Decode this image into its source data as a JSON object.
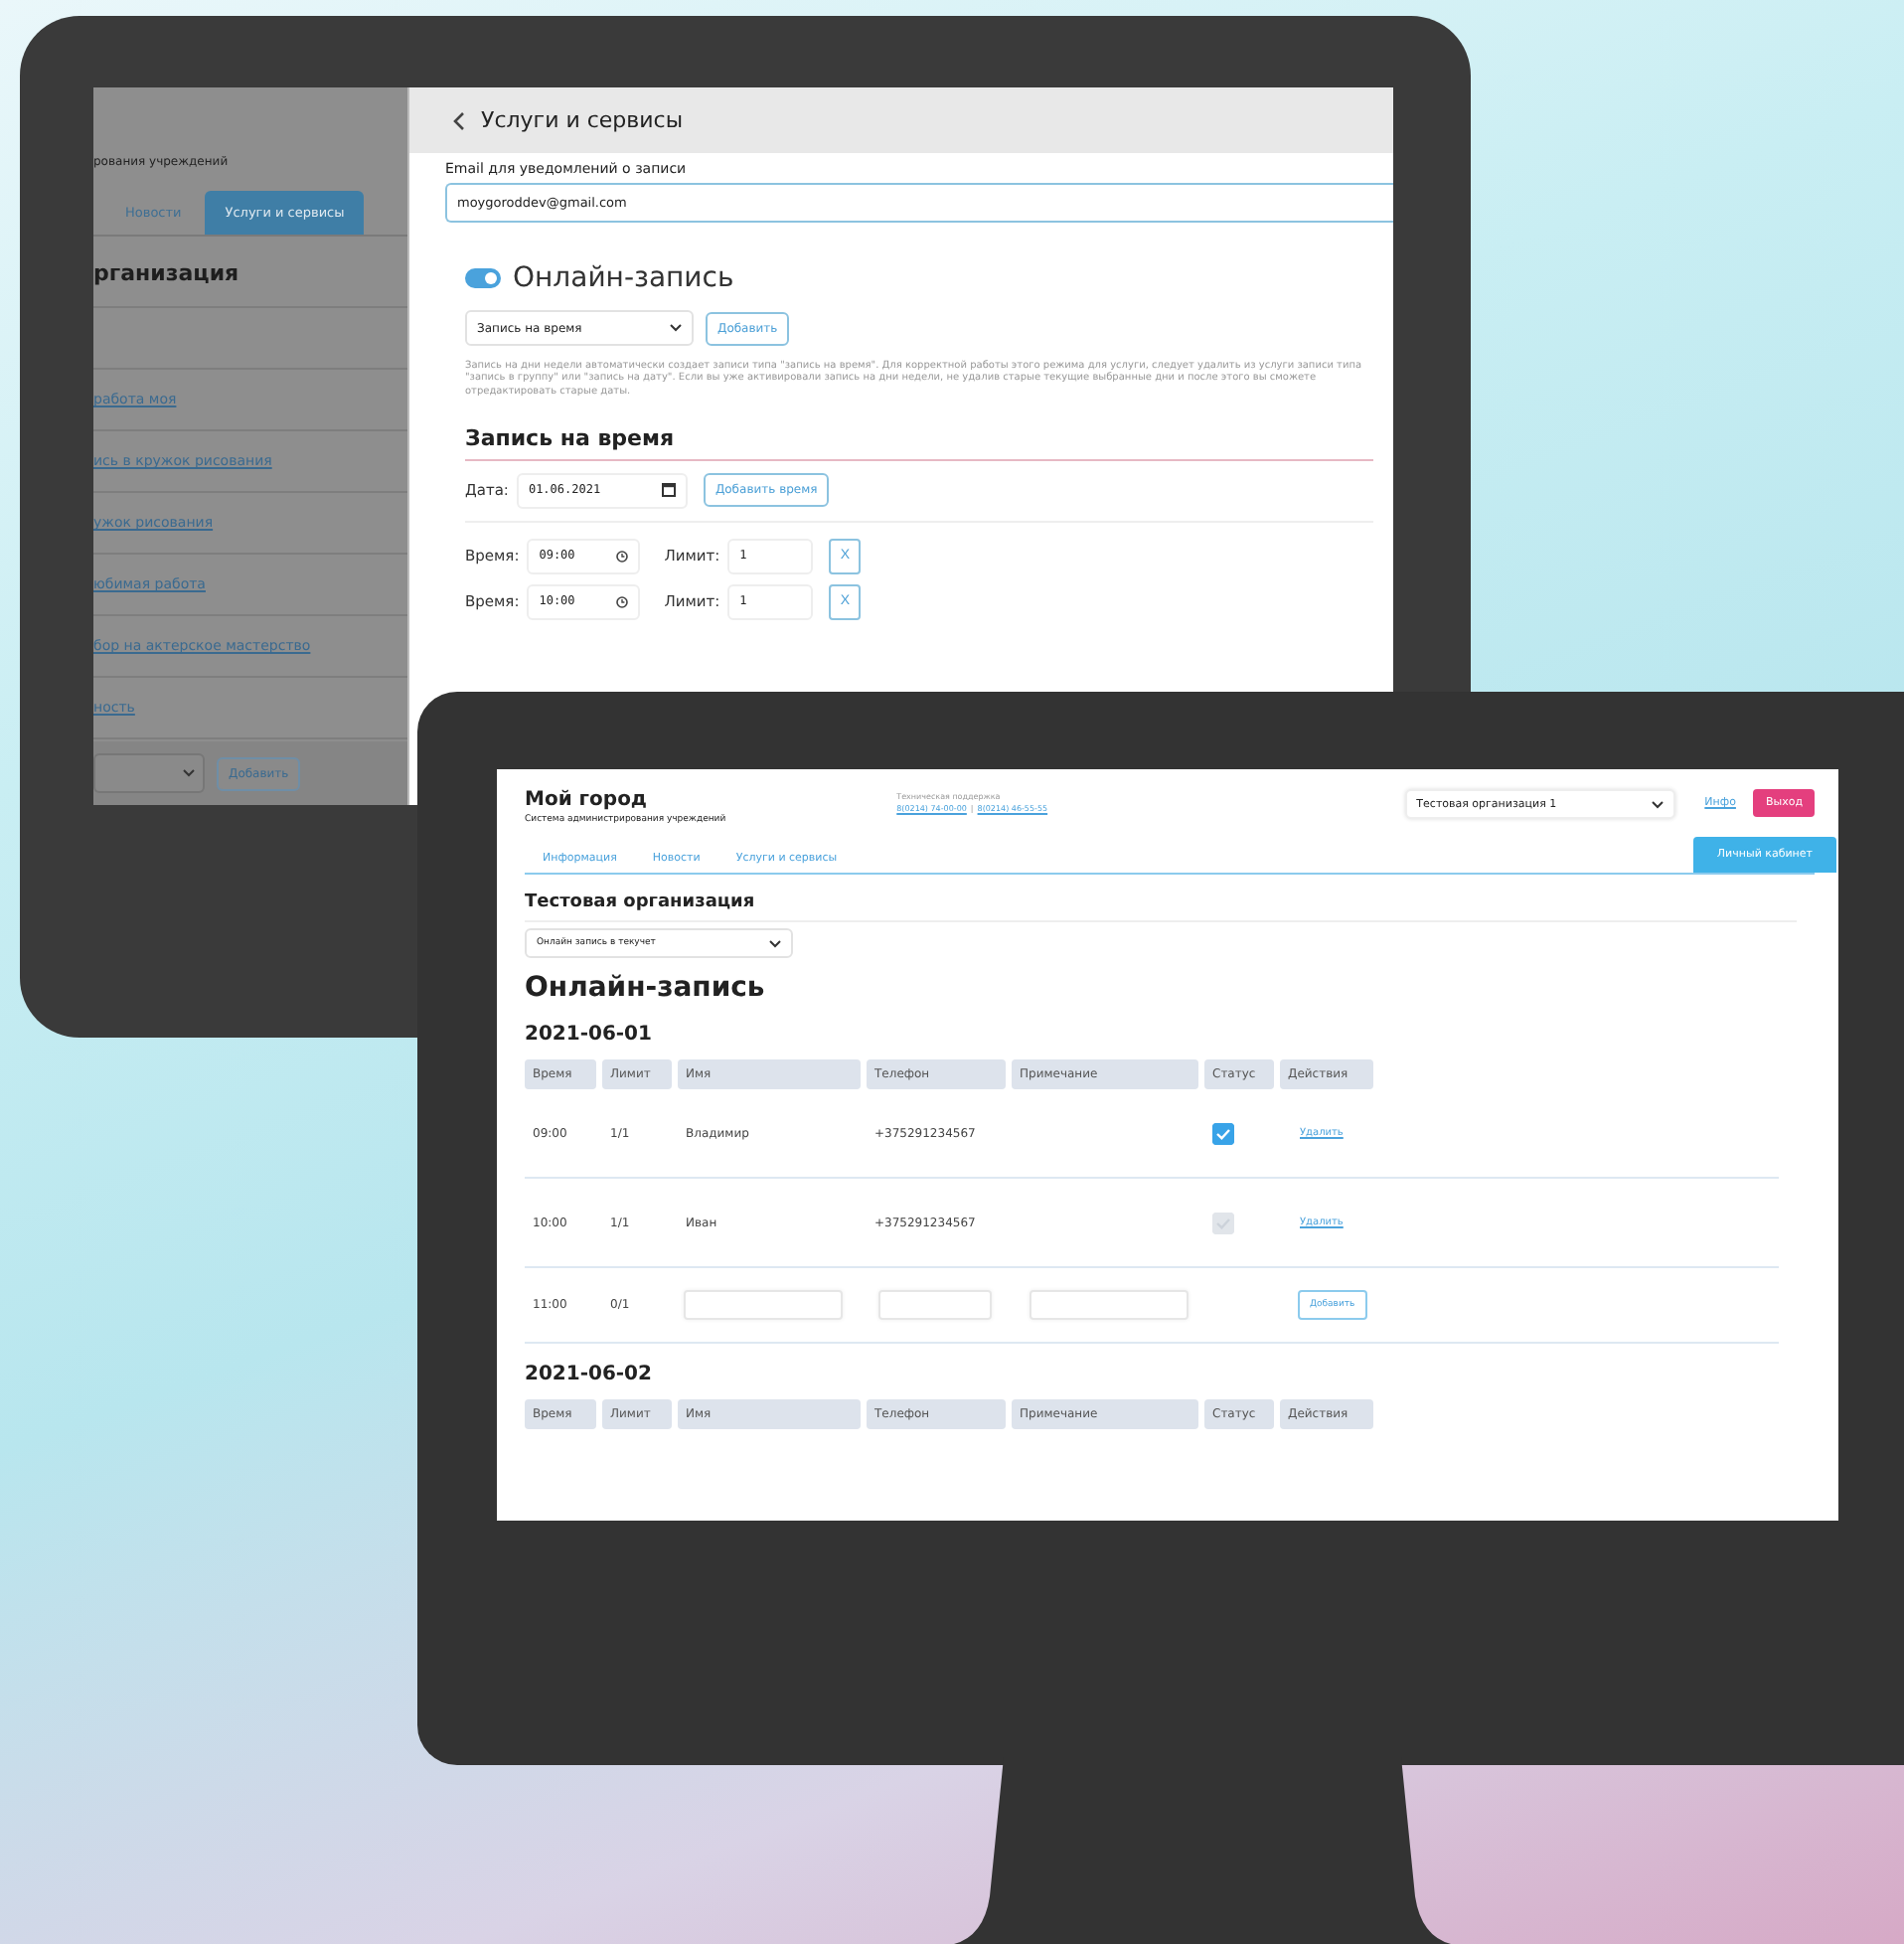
{
  "tablet": {
    "sidebar": {
      "subtitle": "рования учреждений",
      "tabs": [
        {
          "label": "Новости",
          "selected": false
        },
        {
          "label": "Услуги и сервисы",
          "selected": true
        }
      ],
      "heading": "рганизация",
      "links": [
        "работа моя",
        "ись в кружок рисования",
        "ужок рисования",
        "юбимая работа",
        "бор на актерское мастерство",
        "ность"
      ],
      "add_button": "Добавить"
    },
    "panel": {
      "title": "Услуги и сервисы",
      "email_label": "Email для уведомлений о записи",
      "email_value": "moygoroddev@gmail.com",
      "online": {
        "on": true,
        "title": "Онлайн-запись"
      },
      "mode_select": "Запись на время",
      "add_button": "Добавить",
      "note": "Запись на дни недели автоматически создает записи типа \"запись на время\". Для корректной работы этого режима для услуги, следует удалить из услуги записи типа \"запись в группу\" или \"запись на дату\". Если вы уже активировали запись на дни недели, не удалив старые текущие выбранные дни и после этого вы сможете отредактировать старые даты.",
      "section_title": "Запись на время",
      "date_label": "Дата:",
      "date_value": "01.06.2021",
      "add_time_button": "Добавить время",
      "slots": [
        {
          "time_label": "Время:",
          "time": "09:00",
          "limit_label": "Лимит:",
          "limit": "1",
          "remove": "X"
        },
        {
          "time_label": "Время:",
          "time": "10:00",
          "limit_label": "Лимит:",
          "limit": "1",
          "remove": "X"
        }
      ]
    }
  },
  "monitor": {
    "header": {
      "title": "Мой город",
      "subtitle": "Система администрирования учреждений",
      "support_label": "Техническая поддержка",
      "phones": [
        "8(0214) 74-00-00",
        "8(0214) 46-55-55"
      ],
      "phone_separator": "|",
      "org_select": "Тестовая организация 1",
      "info_link": "Инфо",
      "logout_button": "Выход"
    },
    "tabs": [
      "Информация",
      "Новости",
      "Услуги и сервисы"
    ],
    "cabinet_button": "Личный кабинет",
    "org_title": "Тестовая организация",
    "service_select": "Онлайн запись в текучет",
    "page_title": "Онлайн-запись",
    "days": [
      {
        "date": "2021-06-01",
        "columns": [
          "Время",
          "Лимит",
          "Имя",
          "Телефон",
          "Примечание",
          "Статус",
          "Действия"
        ],
        "rows": [
          {
            "kind": "booked",
            "time": "09:00",
            "limit": "1/1",
            "name": "Владимир",
            "phone": "+375291234567",
            "checked": true,
            "action": "Удалить"
          },
          {
            "kind": "booked",
            "time": "10:00",
            "limit": "1/1",
            "name": "Иван",
            "phone": "+375291234567",
            "checked": false,
            "action": "Удалить"
          },
          {
            "kind": "empty",
            "time": "11:00",
            "limit": "0/1",
            "action": "Добавить"
          }
        ]
      },
      {
        "date": "2021-06-02",
        "columns": [
          "Время",
          "Лимит",
          "Имя",
          "Телефон",
          "Примечание",
          "Статус",
          "Действия"
        ]
      }
    ]
  }
}
